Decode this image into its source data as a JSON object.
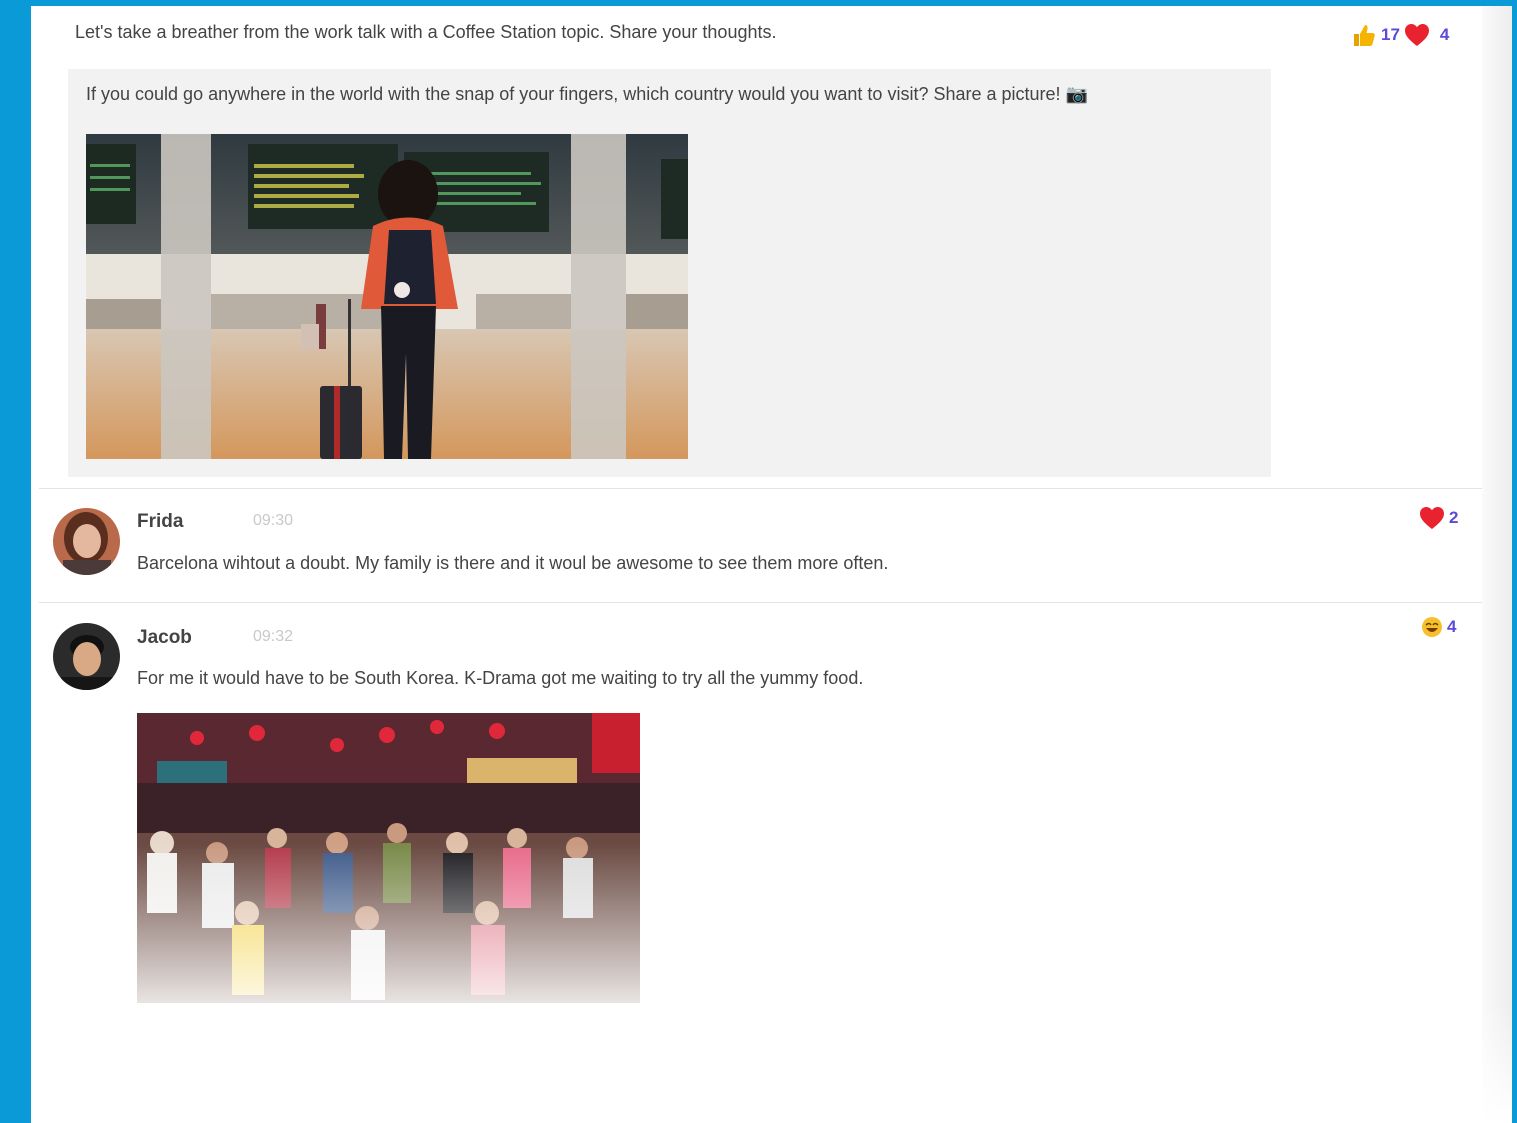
{
  "intro": {
    "text": "Let's take a breather from the work talk with a Coffee Station topic. Share your thoughts.",
    "reactions": {
      "like_count": "17",
      "heart_count": "4"
    }
  },
  "topic": {
    "question": "If you could go anywhere in the world with the snap of your fingers, which country would you want to visit? Share a picture! 📷",
    "image_icon": "airport-photo"
  },
  "comments": [
    {
      "author": "Frida",
      "time": "09:30",
      "text": "Barcelona wihtout a doubt. My family is there and it woul be awesome to see them more often.",
      "reaction_icon": "heart-icon",
      "reaction_count": "2"
    },
    {
      "author": "Jacob",
      "time": "09:32",
      "text": "For me it would have to be South Korea. K-Drama got me waiting to try all the yummy food.",
      "reaction_icon": "smile-emoji-icon",
      "reaction_count": "4",
      "image_icon": "street-market-photo"
    }
  ],
  "colors": {
    "background": "#0a9ad8",
    "count_text": "#5b4bd6",
    "heart": "#e8232f",
    "thumb": "#f4b400"
  }
}
